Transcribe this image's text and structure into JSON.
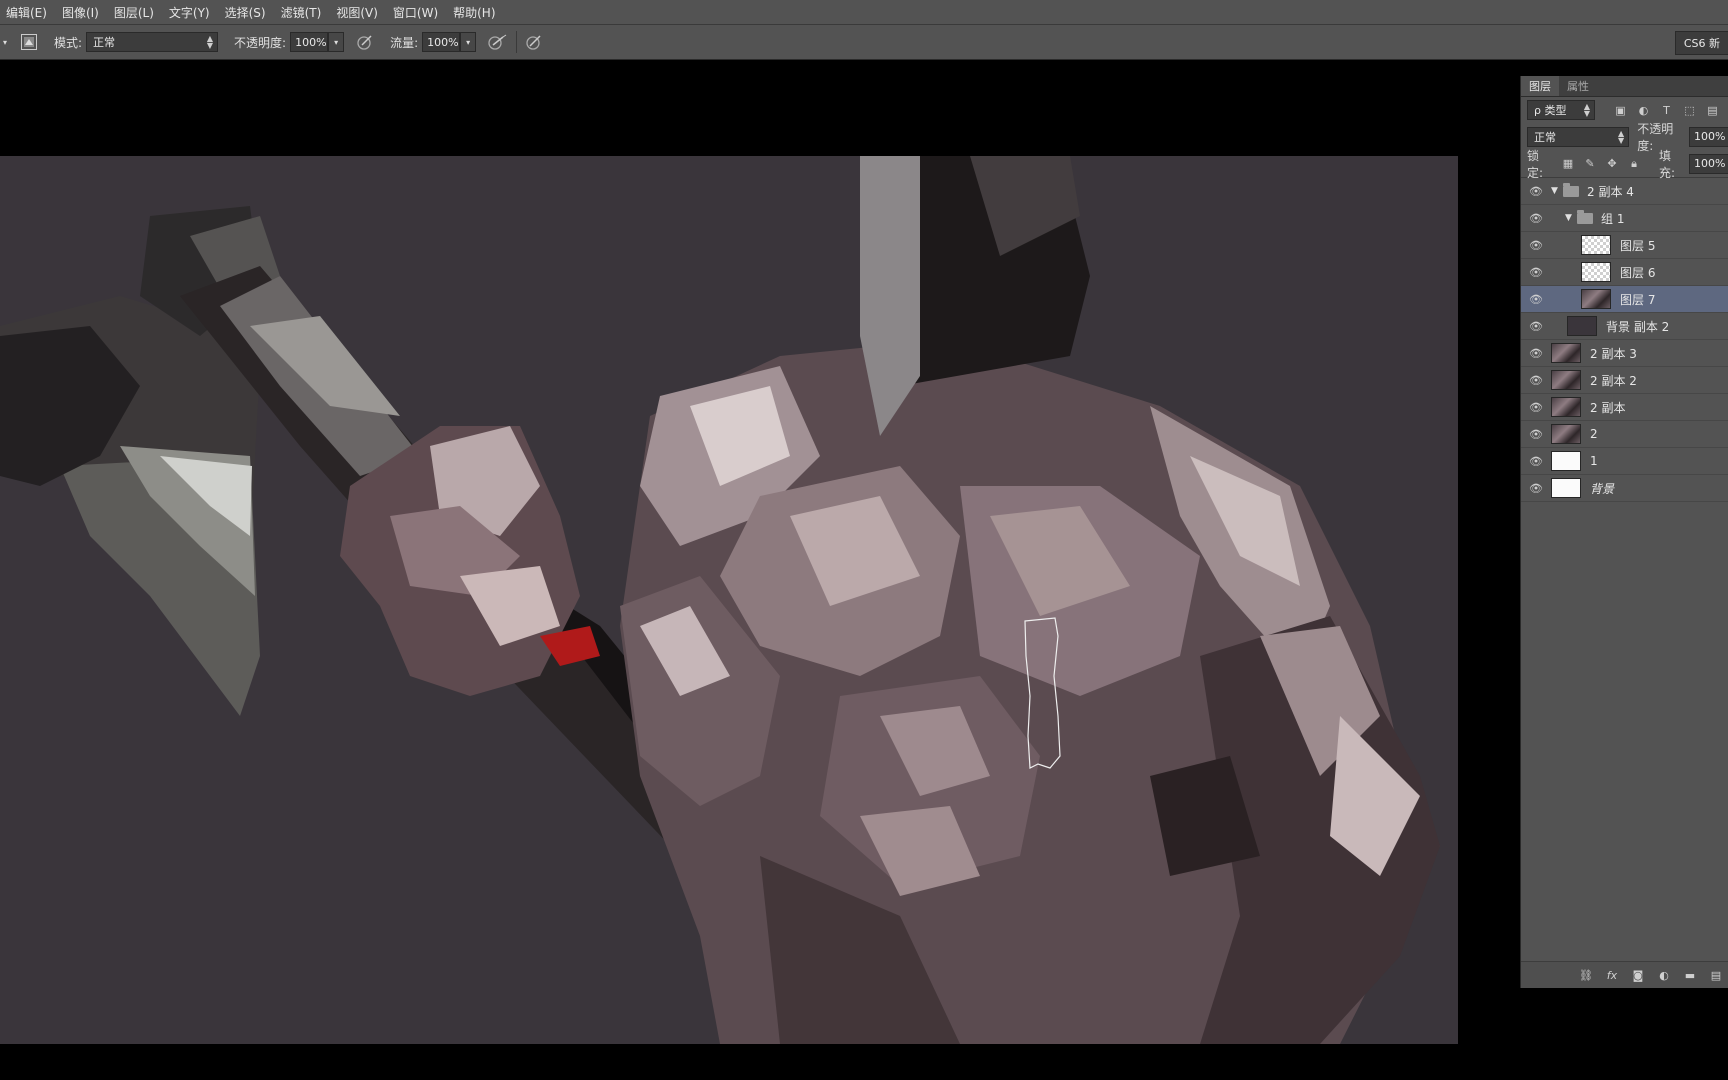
{
  "menu": [
    "编辑(E)",
    "图像(I)",
    "图层(L)",
    "文字(Y)",
    "选择(S)",
    "滤镜(T)",
    "视图(V)",
    "窗口(W)",
    "帮助(H)"
  ],
  "options": {
    "mode_label": "模式:",
    "mode_value": "正常",
    "opacity_label": "不透明度:",
    "opacity_value": "100%",
    "flow_label": "流量:",
    "flow_value": "100%",
    "preset_label": "CS6 新"
  },
  "layers_panel": {
    "tabs": [
      "图层",
      "属性"
    ],
    "filter_kind": "ρ 类型",
    "blend_mode": "正常",
    "opacity_label": "不透明度:",
    "opacity_value": "100%",
    "lock_label": "锁定:",
    "fill_label": "填充:",
    "fill_value": "100%",
    "layers": [
      {
        "name": "2 副本 4",
        "type": "group",
        "indent": 0,
        "expanded": true
      },
      {
        "name": "组 1",
        "type": "group",
        "indent": 1,
        "expanded": true
      },
      {
        "name": "图层 5",
        "type": "layer",
        "thumb": "checker",
        "indent": 2
      },
      {
        "name": "图层 6",
        "type": "layer",
        "thumb": "checker",
        "indent": 2
      },
      {
        "name": "图层 7",
        "type": "layer",
        "thumb": "photo",
        "indent": 2,
        "selected": true
      },
      {
        "name": "背景 副本 2",
        "type": "layer",
        "thumb": "dark",
        "indent": 1
      },
      {
        "name": "2 副本 3",
        "type": "layer",
        "thumb": "photo",
        "indent": 0
      },
      {
        "name": "2 副本 2",
        "type": "layer",
        "thumb": "photo",
        "indent": 0
      },
      {
        "name": "2 副本",
        "type": "layer",
        "thumb": "photo",
        "indent": 0
      },
      {
        "name": "2",
        "type": "layer",
        "thumb": "photo",
        "indent": 0
      },
      {
        "name": "1",
        "type": "layer",
        "thumb": "white",
        "indent": 0
      },
      {
        "name": "背景",
        "type": "layer",
        "thumb": "white",
        "indent": 0,
        "italic": true
      }
    ]
  },
  "colors": {
    "ui_bg": "#535353",
    "canvas_bg": "#3a353b",
    "selection": "#5e6880",
    "accent_red": "#b01a1a"
  }
}
